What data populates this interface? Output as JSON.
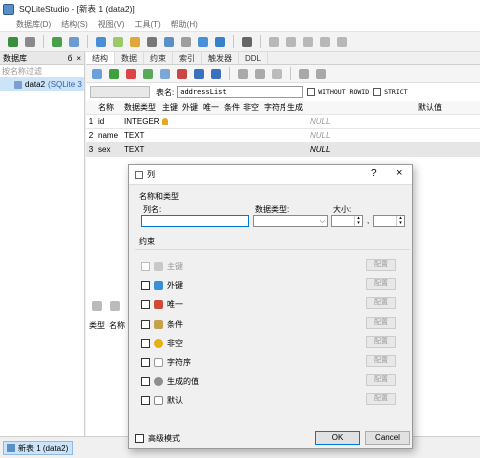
{
  "app": {
    "title": "SQLiteStudio - [新表 1 (data2)]"
  },
  "menu": [
    "数据库(D)",
    "结构(S)",
    "视图(V)",
    "工具(T)",
    "帮助(H)"
  ],
  "db_panel": {
    "header": "数据库",
    "header_buttons": [
      "б",
      "×"
    ],
    "filter_placeholder": "按名称过滤",
    "db_name": "data2",
    "db_path": "(SQLite 3"
  },
  "editor": {
    "tabs": [
      "结构",
      "数据",
      "约束",
      "索引",
      "触发器",
      "DDL"
    ],
    "table_name_label": "表名:",
    "table_name_value": "addressList",
    "without_rowid_label": "WITHOUT ROWID",
    "strict_label": "STRICT",
    "columns_header": [
      "名称",
      "数据类型",
      "主键",
      "外键",
      "唯一",
      "条件",
      "非空",
      "字符序",
      "生成",
      "默认值"
    ],
    "rows": [
      {
        "num": "1",
        "name": "id",
        "type": "INTEGER",
        "pk": true,
        "default": "NULL"
      },
      {
        "num": "2",
        "name": "name",
        "type": "TEXT",
        "pk": false,
        "default": "NULL"
      },
      {
        "num": "3",
        "name": "sex",
        "type": "TEXT",
        "pk": false,
        "default": "NULL"
      }
    ],
    "lower_columns": [
      "类型",
      "名称"
    ]
  },
  "status": {
    "task_label": "新表 1 (data2)"
  },
  "dialog": {
    "title": "列",
    "help_label": "?",
    "close_label": "×",
    "group_name_type": "名称和类型",
    "column_name_label": "列名:",
    "column_name_value": "",
    "data_type_label": "数据类型:",
    "data_type_value": "",
    "size_label": "大小:",
    "size_separator": ",",
    "size_1": "",
    "size_2": "",
    "constraints_label": "约束",
    "constraints": [
      {
        "label": "主键",
        "icon": "key-icon",
        "enabled": false,
        "color": "#b8b8b8"
      },
      {
        "label": "外键",
        "icon": "foreign-key-icon",
        "enabled": true,
        "color": "#3a8fd6"
      },
      {
        "label": "唯一",
        "icon": "unique-icon",
        "enabled": true,
        "color": "#d04a3a"
      },
      {
        "label": "条件",
        "icon": "check-icon",
        "enabled": true,
        "color": "#c8a24a"
      },
      {
        "label": "非空",
        "icon": "not-null-icon",
        "enabled": true,
        "color": "#e5b010"
      },
      {
        "label": "字符序",
        "icon": "collate-icon",
        "enabled": true,
        "color": "#9a9a9a"
      },
      {
        "label": "生成的值",
        "icon": "generated-icon",
        "enabled": true,
        "color": "#8e8e8e"
      },
      {
        "label": "默认",
        "icon": "default-icon",
        "enabled": true,
        "color": "#b0b0b0"
      }
    ],
    "configure_label": "配置",
    "advanced_mode_label": "高级模式",
    "ok_label": "OK",
    "cancel_label": "Cancel"
  }
}
